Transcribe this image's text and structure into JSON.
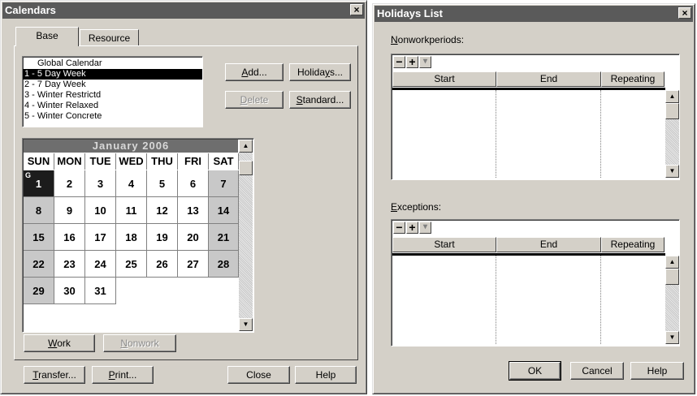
{
  "calendars": {
    "title": "Calendars",
    "close_glyph": "×",
    "tabs": [
      "Base",
      "Resource"
    ],
    "list": [
      "Global Calendar",
      "1 - 5 Day Week",
      "2 - 7 Day Week",
      "3 - Winter Restrictd",
      "4 - Winter Relaxed",
      "5 - Winter Concrete"
    ],
    "selected_index": 1,
    "buttons": {
      "add_pre": "",
      "add_u": "A",
      "add_post": "dd...",
      "holidays_pre": "Holida",
      "holidays_u": "y",
      "holidays_post": "s...",
      "delete_pre": "",
      "delete_u": "D",
      "delete_post": "elete",
      "standard_pre": "",
      "standard_u": "S",
      "standard_post": "tandard...",
      "work_pre": "",
      "work_u": "W",
      "work_post": "ork",
      "nonwork_pre": "",
      "nonwork_u": "N",
      "nonwork_post": "onwork",
      "transfer_pre": "",
      "transfer_u": "T",
      "transfer_post": "ransfer...",
      "print_pre": "",
      "print_u": "P",
      "print_post": "rint...",
      "close": "Close",
      "help": "Help"
    },
    "calendar": {
      "month_label": "January  2006",
      "weekdays": [
        "SUN",
        "MON",
        "TUE",
        "WED",
        "THU",
        "FRI",
        "SAT"
      ],
      "weeks": [
        [
          "1",
          "2",
          "3",
          "4",
          "5",
          "6",
          "7"
        ],
        [
          "8",
          "9",
          "10",
          "11",
          "12",
          "13",
          "14"
        ],
        [
          "15",
          "16",
          "17",
          "18",
          "19",
          "20",
          "21"
        ],
        [
          "22",
          "23",
          "24",
          "25",
          "26",
          "27",
          "28"
        ],
        [
          "29",
          "30",
          "31",
          "",
          "",
          "",
          ""
        ]
      ],
      "today_marker": "G",
      "scroll_up": "▲",
      "scroll_down": "▼"
    }
  },
  "holidays": {
    "title": "Holidays List",
    "close_glyph": "×",
    "nonwork_label_u": "N",
    "nonwork_label_post": "onworkperiods:",
    "exceptions_label_u": "E",
    "exceptions_label_post": "xceptions:",
    "toolbar": {
      "minus": "−",
      "plus": "+",
      "dropdown": "▾"
    },
    "columns": [
      "Start",
      "End",
      "Repeating"
    ],
    "scroll_up": "▲",
    "scroll_down": "▼",
    "buttons": {
      "ok": "OK",
      "cancel": "Cancel",
      "help": "Help"
    }
  },
  "colors": {
    "titlebar": "#5a5a5a",
    "face": "#d4d0c8",
    "selection": "#000000",
    "weekend": "#c8c8c8",
    "month_header": "#6e6e6e"
  }
}
